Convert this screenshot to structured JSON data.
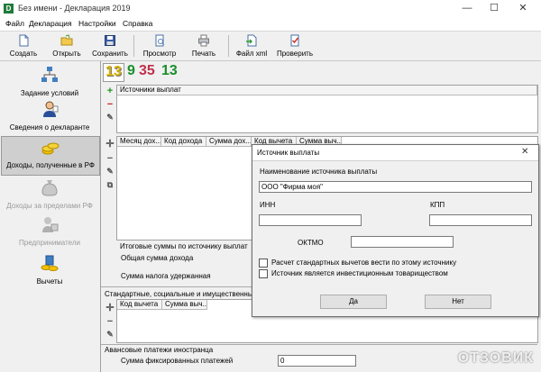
{
  "window": {
    "title": "Без имени - Декларация 2019",
    "app_icon_letter": "D",
    "minimize_glyph": "—",
    "maximize_glyph": "☐",
    "close_glyph": "✕"
  },
  "menu": {
    "items": [
      "Файл",
      "Декларация",
      "Настройки",
      "Справка"
    ]
  },
  "toolbar": {
    "buttons": [
      {
        "label": "Создать",
        "icon": "new-document-icon"
      },
      {
        "label": "Открыть",
        "icon": "open-folder-icon"
      },
      {
        "label": "Сохранить",
        "icon": "save-disk-icon"
      },
      {
        "label": "Просмотр",
        "icon": "preview-icon"
      },
      {
        "label": "Печать",
        "icon": "printer-icon"
      },
      {
        "label": "Файл xml",
        "icon": "xml-file-icon"
      },
      {
        "label": "Проверить",
        "icon": "check-icon"
      }
    ]
  },
  "sidebar": {
    "items": [
      {
        "label": "Задание условий",
        "icon": "conditions-icon",
        "state": "normal"
      },
      {
        "label": "Сведения о декларанте",
        "icon": "person-icon",
        "state": "normal"
      },
      {
        "label": "Доходы, полученные в РФ",
        "icon": "coins-icon",
        "state": "selected"
      },
      {
        "label": "Доходы за пределами РФ",
        "icon": "money-bag-icon",
        "state": "disabled"
      },
      {
        "label": "Предприниматели",
        "icon": "entrepreneur-icon",
        "state": "disabled"
      },
      {
        "label": "Вычеты",
        "icon": "deductions-icon",
        "state": "normal"
      }
    ]
  },
  "rate_tabs": [
    {
      "label": "13",
      "color": "#d9b100",
      "active": true
    },
    {
      "label": "9",
      "color": "#1a8f2a",
      "active": false
    },
    {
      "label": "35",
      "color": "#c0304a",
      "active": false
    },
    {
      "label": "13",
      "color": "#1a8f2a",
      "active": false
    }
  ],
  "sources_panel": {
    "header": "Источники выплат"
  },
  "income_table": {
    "headers": [
      "Месяц дох...",
      "Код дохода",
      "Сумма дох...",
      "Код вычета",
      "Сумма выч..."
    ]
  },
  "totals": {
    "title": "Итоговые суммы по источнику выплат",
    "income_label": "Общая сумма дохода",
    "tax_label": "Сумма налога удержанная"
  },
  "deductions_section": {
    "title": "Стандартные, социальные и имущественные налоговые вычеты",
    "headers": [
      "Код вычета",
      "Сумма выч..."
    ]
  },
  "foreign_advance": {
    "title": "Авансовые платежи иностранца",
    "fixed_label": "Сумма фиксированных платежей",
    "fixed_value": "0"
  },
  "dialog": {
    "title": "Источник выплаты",
    "name_label": "Наименование источника выплаты",
    "name_value": "ООО \"Фирма моя\"",
    "inn_label": "ИНН",
    "kpp_label": "КПП",
    "oktmo_label": "ОКТМО",
    "checkbox1": "Расчет стандартных вычетов вести по этому источнику",
    "checkbox2": "Источник является инвестиционным товариществом",
    "ok": "Да",
    "cancel": "Нет"
  },
  "watermark": "ОТЗОВИК"
}
